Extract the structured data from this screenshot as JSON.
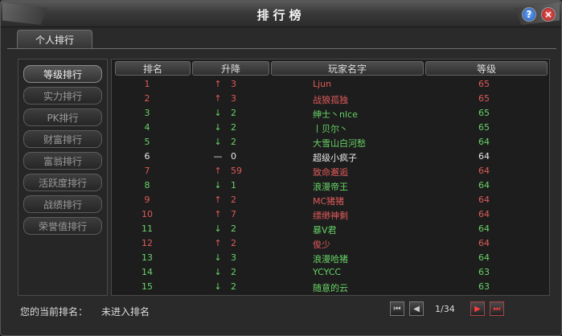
{
  "window": {
    "title": "排行榜"
  },
  "tabs": [
    {
      "label": "个人排行"
    }
  ],
  "sidebar": {
    "items": [
      {
        "label": "等级排行",
        "active": true
      },
      {
        "label": "实力排行",
        "active": false
      },
      {
        "label": "PK排行",
        "active": false
      },
      {
        "label": "财富排行",
        "active": false
      },
      {
        "label": "富翁排行",
        "active": false
      },
      {
        "label": "活跃度排行",
        "active": false
      },
      {
        "label": "战绩排行",
        "active": false
      },
      {
        "label": "荣誉值排行",
        "active": false
      }
    ]
  },
  "table": {
    "headers": [
      "排名",
      "升降",
      "玩家名字",
      "等级"
    ],
    "rows": [
      {
        "rank": "1",
        "arrow": "↑",
        "change": "3",
        "name": "Ljun",
        "level": "65",
        "color": "red",
        "arrow_color": "red"
      },
      {
        "rank": "2",
        "arrow": "↑",
        "change": "3",
        "name": "战狼孤独",
        "level": "65",
        "color": "red",
        "arrow_color": "red"
      },
      {
        "rank": "3",
        "arrow": "↓",
        "change": "2",
        "name": "绅士丶nlce",
        "level": "65",
        "color": "green",
        "arrow_color": "green"
      },
      {
        "rank": "4",
        "arrow": "↓",
        "change": "2",
        "name": "丨贝尔丶",
        "level": "65",
        "color": "green",
        "arrow_color": "green"
      },
      {
        "rank": "5",
        "arrow": "↓",
        "change": "2",
        "name": "大雪山白河愁",
        "level": "64",
        "color": "green",
        "arrow_color": "green"
      },
      {
        "rank": "6",
        "arrow": "—",
        "change": "0",
        "name": "超级小疯子",
        "level": "64",
        "color": "white",
        "arrow_color": "white"
      },
      {
        "rank": "7",
        "arrow": "↑",
        "change": "59",
        "name": "致命邂逅",
        "level": "64",
        "color": "red",
        "arrow_color": "red"
      },
      {
        "rank": "8",
        "arrow": "↓",
        "change": "1",
        "name": "浪漫帝王",
        "level": "64",
        "color": "green",
        "arrow_color": "green"
      },
      {
        "rank": "9",
        "arrow": "↑",
        "change": "2",
        "name": "MC猪猪",
        "level": "64",
        "color": "red",
        "arrow_color": "red"
      },
      {
        "rank": "10",
        "arrow": "↑",
        "change": "7",
        "name": "缥缈神剩",
        "level": "64",
        "color": "red",
        "arrow_color": "red"
      },
      {
        "rank": "11",
        "arrow": "↓",
        "change": "2",
        "name": "暴V君",
        "level": "64",
        "color": "green",
        "arrow_color": "green"
      },
      {
        "rank": "12",
        "arrow": "↑",
        "change": "2",
        "name": "俊少",
        "level": "64",
        "color": "red",
        "arrow_color": "red"
      },
      {
        "rank": "13",
        "arrow": "↓",
        "change": "3",
        "name": "浪漫哈猪",
        "level": "64",
        "color": "green",
        "arrow_color": "green"
      },
      {
        "rank": "14",
        "arrow": "↓",
        "change": "2",
        "name": "YCYCC",
        "level": "63",
        "color": "green",
        "arrow_color": "green"
      },
      {
        "rank": "15",
        "arrow": "↓",
        "change": "2",
        "name": "随意的云",
        "level": "63",
        "color": "green",
        "arrow_color": "green"
      }
    ]
  },
  "footer": {
    "current_rank_label": "您的当前排名：",
    "current_rank_value": "未进入排名",
    "page": "1/34"
  },
  "colors": {
    "red": "#e05a5a",
    "green": "#66d466",
    "white": "#e6e6e6"
  }
}
